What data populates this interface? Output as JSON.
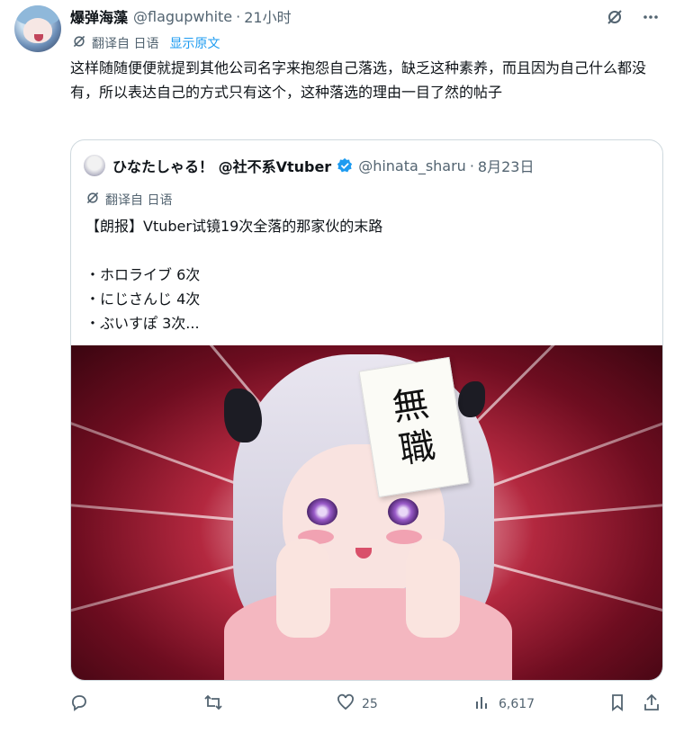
{
  "author": {
    "name": "爆弹海藻",
    "handle": "@flagupwhite",
    "separator": "·",
    "time": "21小时"
  },
  "translation": {
    "label": "翻译自 日语",
    "show_original": "显示原文"
  },
  "post_text": "这样随随便便就提到其他公司名字来抱怨自己落选，缺乏这种素养，而且因为自己什么都没有，所以表达自己的方式只有这个，这种落选的理由一目了然的帖子",
  "quote": {
    "name": "ひなたしゃる！ @社不系Vtuber",
    "handle": "@hinata_sharu",
    "separator": "·",
    "date": "8月23日",
    "translation_label": "翻译自 日语",
    "lines": [
      "【朗报】Vtuber试镜19次全落的那家伙的末路",
      "",
      "・ホロライブ 6次",
      "・にじさんじ 4次",
      "・ぶいすぽ 3次..."
    ],
    "image": {
      "paper_text": [
        "無",
        "職"
      ]
    }
  },
  "actions": {
    "reply_count": "",
    "repost_count": "",
    "like_count": "25",
    "view_count": "6,617"
  },
  "icons": {
    "grok": "grok-icon",
    "more": "more-options-icon",
    "translate": "translate-icon",
    "verified": "verified-badge-icon",
    "reply": "reply-icon",
    "repost": "repost-icon",
    "like": "heart-icon",
    "views": "views-chart-icon",
    "bookmark": "bookmark-icon",
    "share": "share-icon"
  },
  "colors": {
    "link": "#1d9bf0",
    "muted": "#536471",
    "text": "#0f1419",
    "border": "#cfd9de"
  }
}
